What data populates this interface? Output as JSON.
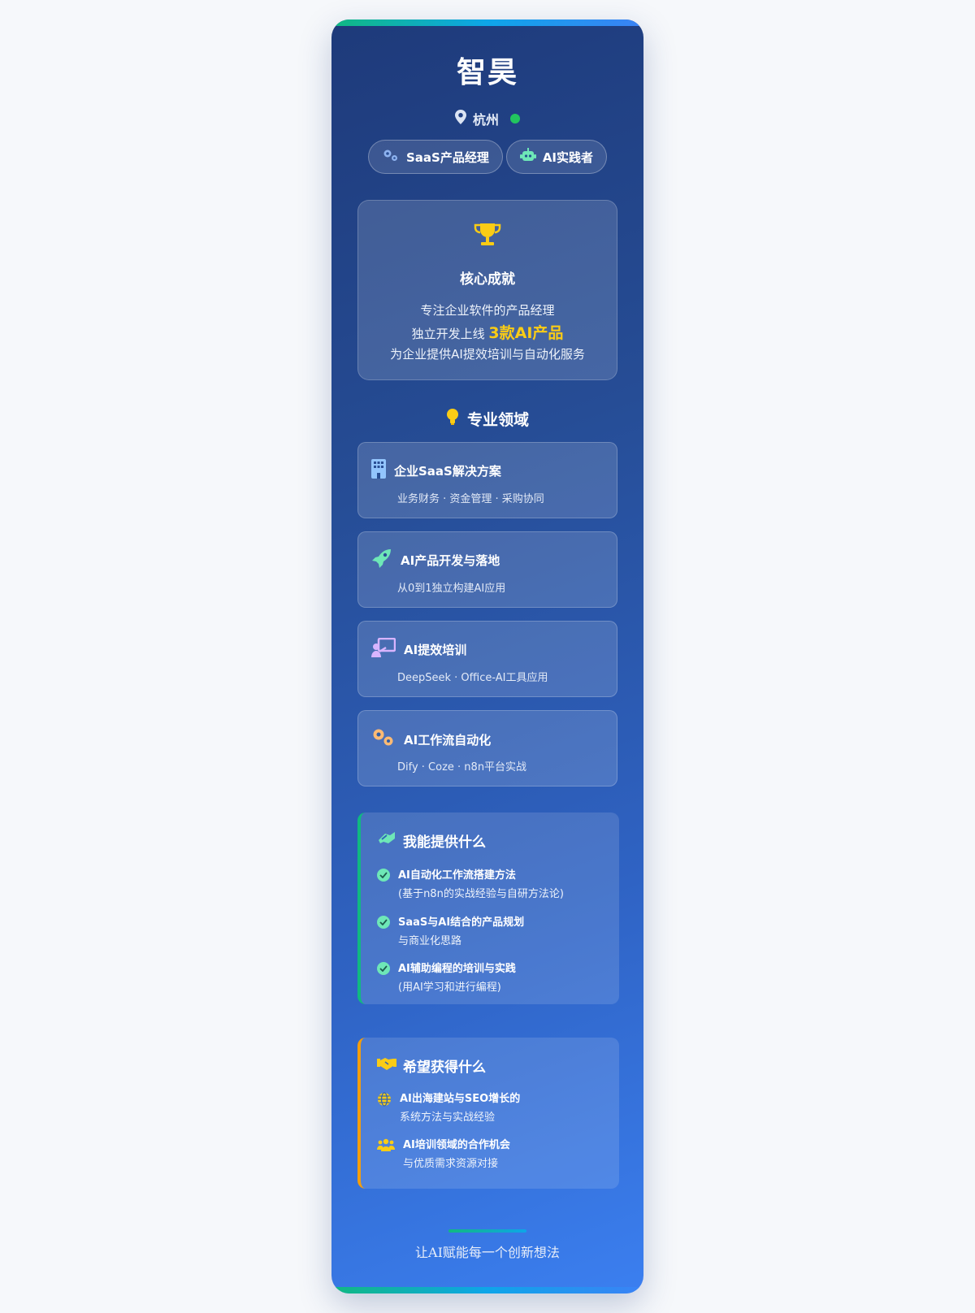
{
  "profile": {
    "name": "智昊",
    "location": "杭州"
  },
  "tags": [
    "SaaS产品经理",
    "AI实践者"
  ],
  "achievement": {
    "title": "核心成就",
    "line1": "专注企业软件的产品经理",
    "line2_prefix": "独立开发上线",
    "line2_highlight": "3款AI产品",
    "line3": "为企业提供AI提效培训与自动化服务"
  },
  "fields": {
    "title": "专业领域",
    "items": [
      {
        "title": "企业SaaS解决方案",
        "desc": "业务财务 · 资金管理 · 采购协同",
        "icon": "building-icon"
      },
      {
        "title": "AI产品开发与落地",
        "desc": "从0到1独立构建AI应用",
        "icon": "rocket-icon"
      },
      {
        "title": "AI提效培训",
        "desc": "DeepSeek · Office-AI工具应用",
        "icon": "teacher-icon"
      },
      {
        "title": "AI工作流自动化",
        "desc": "Dify · Coze · n8n平台实战",
        "icon": "gears-icon"
      }
    ]
  },
  "offer": {
    "title": "我能提供什么",
    "items": [
      {
        "line1": "AI自动化工作流搭建方法",
        "line2": "(基于n8n的实战经验与自研方法论)"
      },
      {
        "line1": "SaaS与AI结合的产品规划",
        "line2": "与商业化思路"
      },
      {
        "line1": "AI辅助编程的培训与实践",
        "line2": "(用AI学习和进行编程)"
      }
    ]
  },
  "want": {
    "title": "希望获得什么",
    "items": [
      {
        "line1": "AI出海建站与SEO增长的",
        "line2": "系统方法与实战经验",
        "icon": "globe-icon"
      },
      {
        "line1": "AI培训领域的合作机会",
        "line2": "与优质需求资源对接",
        "icon": "users-icon"
      }
    ]
  },
  "slogan": "让AI赋能每一个创新想法",
  "colors": {
    "accent_green": "#10b981",
    "accent_orange": "#f59e0b",
    "highlight_yellow": "#facc15",
    "status_online": "#22c55e"
  }
}
